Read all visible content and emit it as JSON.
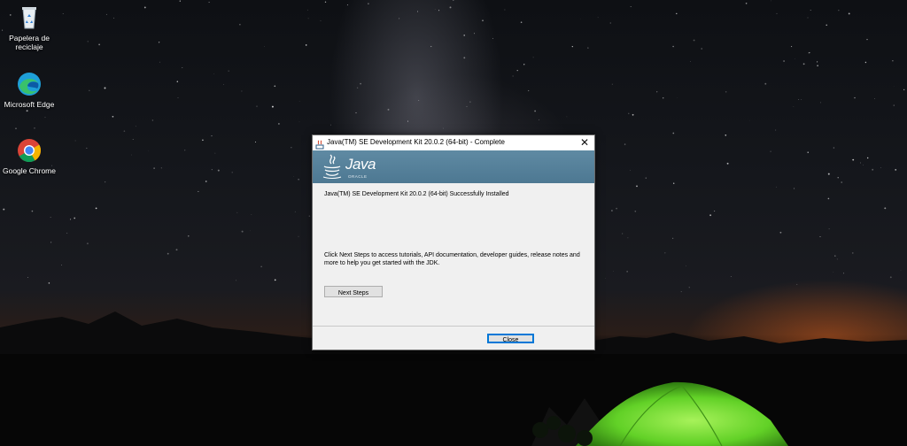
{
  "desktop": {
    "icons": [
      {
        "label": "Papelera de reciclaje",
        "icon": "recycle-bin-icon"
      },
      {
        "label": "Microsoft Edge",
        "icon": "edge-icon"
      },
      {
        "label": "Google Chrome",
        "icon": "chrome-icon"
      }
    ]
  },
  "dialog": {
    "title": "Java(TM) SE Development Kit 20.0.2 (64-bit) - Complete",
    "close_glyph": "✕",
    "banner": {
      "brand": "Java",
      "sub_brand": "ORACLE"
    },
    "success_message": "Java(TM) SE Development Kit 20.0.2 (64-bit) Successfully Installed",
    "info_message": "Click Next Steps to access tutorials, API documentation, developer guides, release notes and more to help you get started with the JDK.",
    "next_steps_label": "Next Steps",
    "close_label": "Close"
  },
  "colors": {
    "banner": "#4d7892",
    "dialog_bg": "#f0f0f0",
    "focus_border": "#0078d7",
    "tent": "#6fdc2c"
  }
}
